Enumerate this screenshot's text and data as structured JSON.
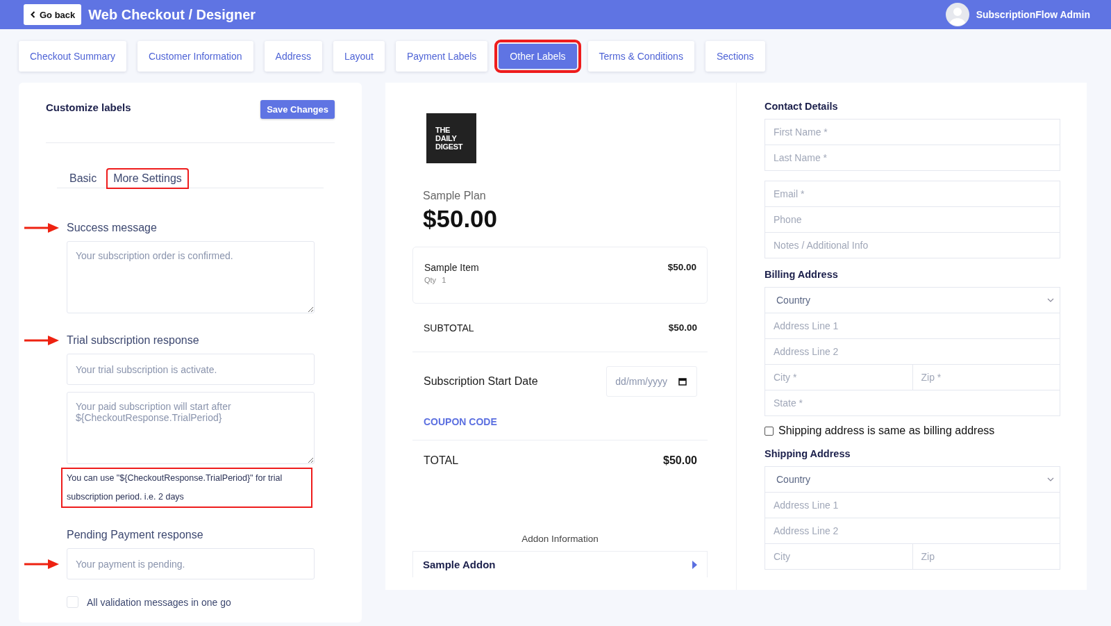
{
  "header": {
    "back_label": "Go back",
    "title": "Web Checkout / Designer",
    "user": "SubscriptionFlow Admin"
  },
  "tabs": [
    {
      "label": "Checkout Summary",
      "selected": false,
      "highlighted": false
    },
    {
      "label": "Customer Information",
      "selected": false,
      "highlighted": false
    },
    {
      "label": "Address",
      "selected": false,
      "highlighted": false
    },
    {
      "label": "Layout",
      "selected": false,
      "highlighted": false
    },
    {
      "label": "Payment Labels",
      "selected": false,
      "highlighted": false
    },
    {
      "label": "Other Labels",
      "selected": true,
      "highlighted": true
    },
    {
      "label": "Terms & Conditions",
      "selected": false,
      "highlighted": false
    },
    {
      "label": "Sections",
      "selected": false,
      "highlighted": false
    }
  ],
  "editor": {
    "title": "Customize labels",
    "save_label": "Save Changes",
    "subtabs": [
      {
        "label": "Basic",
        "selected": false,
        "highlighted": false
      },
      {
        "label": "More Settings",
        "selected": true,
        "highlighted": true
      }
    ],
    "fields": [
      {
        "label": "Success message",
        "arrow_at_label": true,
        "arrow_at_input": false,
        "inputs": [
          {
            "kind": "textarea",
            "placeholder": "Your subscription order is confirmed."
          }
        ]
      },
      {
        "label": "Trial subscription response",
        "arrow_at_label": true,
        "arrow_at_input": false,
        "inputs": [
          {
            "kind": "input",
            "placeholder": "Your trial subscription is activate."
          },
          {
            "kind": "textarea",
            "placeholder": "Your paid subscription will start after ${CheckoutResponse.TrialPeriod}"
          }
        ],
        "hint": "You can use \"${CheckoutResponse.TrialPeriod}\" for trial subscription period. i.e. 2 days",
        "hint_highlighted": true
      },
      {
        "label": "Pending Payment response",
        "arrow_at_label": false,
        "arrow_at_input": true,
        "inputs": [
          {
            "kind": "input",
            "placeholder": "Your payment is pending."
          }
        ]
      }
    ],
    "checkbox": {
      "label": "All validation messages in one go",
      "checked": false
    }
  },
  "preview": {
    "logo_lines": [
      "THE",
      "DAILY",
      "DIGEST"
    ],
    "plan_name": "Sample Plan",
    "plan_price": "$50.00",
    "item": {
      "name": "Sample Item",
      "qty_label": "Qty",
      "qty": "1",
      "price": "$50.00"
    },
    "subtotal_label": "SUBTOTAL",
    "subtotal": "$50.00",
    "start_date_label": "Subscription Start Date",
    "date_placeholder": "dd/mm/yyyy",
    "coupon_label": "COUPON CODE",
    "total_label": "TOTAL",
    "total": "$50.00",
    "addon_heading": "Addon Information",
    "addon_name": "Sample Addon"
  },
  "form": {
    "sections": [
      {
        "title": "Contact Details",
        "groups": [
          [
            [
              {
                "kind": "input",
                "placeholder": "First Name *"
              }
            ],
            [
              {
                "kind": "input",
                "placeholder": "Last Name *"
              }
            ]
          ],
          [
            [
              {
                "kind": "input",
                "placeholder": "Email *"
              }
            ],
            [
              {
                "kind": "input",
                "placeholder": "Phone"
              }
            ],
            [
              {
                "kind": "input",
                "placeholder": "Notes / Additional Info"
              }
            ]
          ]
        ]
      },
      {
        "title": "Billing Address",
        "groups": [
          [
            [
              {
                "kind": "select",
                "placeholder": "Country"
              }
            ],
            [
              {
                "kind": "input",
                "placeholder": "Address Line 1"
              }
            ],
            [
              {
                "kind": "input",
                "placeholder": "Address Line 2"
              }
            ],
            [
              {
                "kind": "input",
                "placeholder": "City *"
              },
              {
                "kind": "input",
                "placeholder": "Zip *"
              }
            ],
            [
              {
                "kind": "input",
                "placeholder": "State *"
              }
            ]
          ]
        ],
        "checkbox": {
          "label": "Shipping address is same as billing address",
          "checked": false
        }
      },
      {
        "title": "Shipping Address",
        "groups": [
          [
            [
              {
                "kind": "select",
                "placeholder": "Country"
              }
            ],
            [
              {
                "kind": "input",
                "placeholder": "Address Line 1"
              }
            ],
            [
              {
                "kind": "input",
                "placeholder": "Address Line 2"
              }
            ],
            [
              {
                "kind": "input",
                "placeholder": "City"
              },
              {
                "kind": "input",
                "placeholder": "Zip"
              }
            ]
          ]
        ]
      }
    ]
  }
}
